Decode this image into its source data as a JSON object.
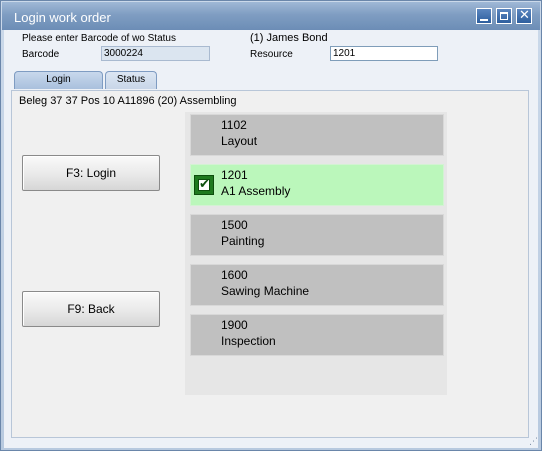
{
  "window": {
    "title": "Login work order",
    "controls": {
      "minimize": "minimize-icon",
      "maximize": "maximize-icon",
      "close_glyph": "✕"
    }
  },
  "header": {
    "prompt": "Please enter Barcode of wo Status",
    "user": "(1) James Bond",
    "barcode_label": "Barcode",
    "barcode_value": "3000224",
    "resource_label": "Resource",
    "resource_value": "1201"
  },
  "tabs": [
    {
      "label": "Login",
      "active": true
    },
    {
      "label": "Status",
      "active": false
    }
  ],
  "info_line": "Beleg 37 37 Pos 10 A11896 (20) Assembling",
  "buttons": {
    "login": "F3: Login",
    "back": "F9: Back"
  },
  "resources": [
    {
      "code": "1102",
      "name": "Layout",
      "selected": false
    },
    {
      "code": "1201",
      "name": "A1 Assembly",
      "selected": true
    },
    {
      "code": "1500",
      "name": "Painting",
      "selected": false
    },
    {
      "code": "1600",
      "name": "Sawing Machine",
      "selected": false
    },
    {
      "code": "1900",
      "name": "Inspection",
      "selected": false
    }
  ],
  "colors": {
    "selected_bg": "#bbf7bb",
    "item_bg": "#c0c0c0",
    "check_green": "#1e7a1e"
  }
}
